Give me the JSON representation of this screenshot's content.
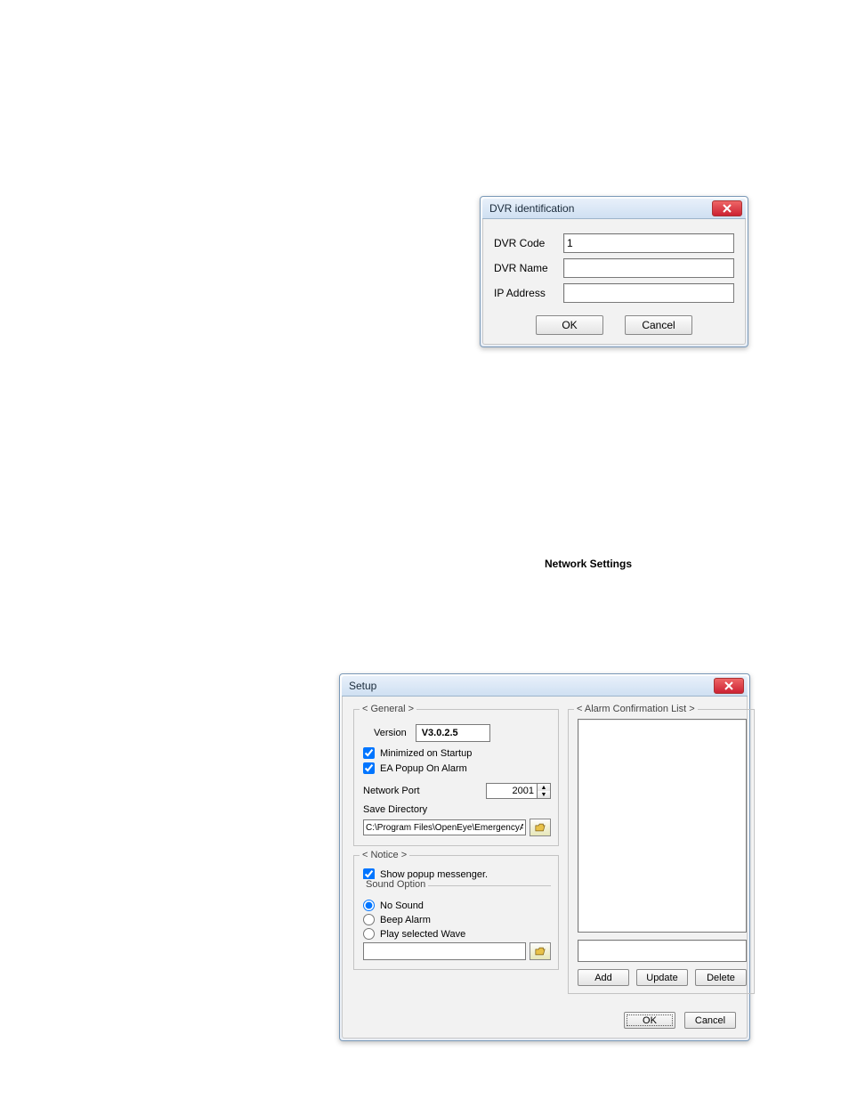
{
  "dlg1": {
    "title": "DVR identification",
    "fields": {
      "code_label": "DVR Code",
      "code_value": "1",
      "name_label": "DVR Name",
      "name_value": "",
      "ip_label": "IP Address",
      "ip_value": ""
    },
    "buttons": {
      "ok": "OK",
      "cancel": "Cancel"
    }
  },
  "heading1": "Network Settings",
  "dlg2": {
    "title": "Setup",
    "general": {
      "legend": "< General >",
      "version_label": "Version",
      "version_value": "V3.0.2.5",
      "min_startup": "Minimized on Startup",
      "ea_popup": "EA Popup On Alarm",
      "port_label": "Network Port",
      "port_value": "2001",
      "savedir_label": "Save Directory",
      "savedir_value": "C:\\Program Files\\OpenEye\\EmergencyAgent\\E"
    },
    "notice": {
      "legend": "< Notice >",
      "show_popup": "Show popup messenger.",
      "sound_legend": "Sound Option",
      "no_sound": "No Sound",
      "beep": "Beep Alarm",
      "play_wave": "Play selected Wave",
      "wave_path": ""
    },
    "alarm": {
      "legend": "< Alarm Confirmation List >",
      "input_value": "",
      "add": "Add",
      "update": "Update",
      "delete": "Delete"
    },
    "buttons": {
      "ok": "OK",
      "cancel": "Cancel"
    }
  }
}
